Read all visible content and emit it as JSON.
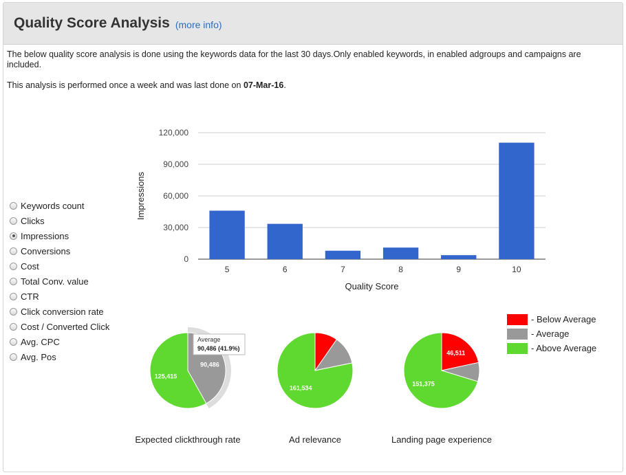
{
  "header": {
    "title": "Quality Score Analysis",
    "more_info": "(more info)"
  },
  "description": {
    "line1": "The below quality score analysis is done using the keywords data for the last 30 days.Only enabled keywords, in enabled adgroups and campaigns are included.",
    "line2_prefix": "This analysis is performed once a week and was last done on ",
    "line2_date": "07-Mar-16",
    "line2_suffix": "."
  },
  "metrics": {
    "selected": "Impressions",
    "options": [
      "Keywords count",
      "Clicks",
      "Impressions",
      "Conversions",
      "Cost",
      "Total Conv. value",
      "CTR",
      "Click conversion rate",
      "Cost / Converted Click",
      "Avg. CPC",
      "Avg. Pos"
    ]
  },
  "legend": {
    "items": [
      {
        "label": "- Below Average",
        "color": "#ff0000"
      },
      {
        "label": "- Average",
        "color": "#999999"
      },
      {
        "label": "- Above Average",
        "color": "#5fd92f"
      }
    ]
  },
  "chart_data": [
    {
      "type": "bar",
      "categories": [
        "5",
        "6",
        "7",
        "8",
        "9",
        "10"
      ],
      "values": [
        46000,
        33500,
        8000,
        11000,
        3800,
        110500
      ],
      "xlabel": "Quality Score",
      "ylabel": "Impressions",
      "ylim": [
        0,
        120000
      ],
      "yticks": [
        0,
        30000,
        60000,
        90000,
        120000
      ],
      "ytick_labels": [
        "0",
        "30,000",
        "60,000",
        "90,000",
        "120,000"
      ],
      "color": "#3366cc",
      "grid": true
    },
    {
      "type": "pie",
      "title": "Expected clickthrough rate",
      "labels": [
        "Below Average",
        "Average",
        "Above Average"
      ],
      "values": [
        0,
        90486,
        125415
      ],
      "colors": [
        "#ff0000",
        "#999999",
        "#5fd92f"
      ],
      "slice_labels": [
        "",
        "90,486",
        "125,415"
      ],
      "highlighted": "Average",
      "tooltip": {
        "title": "Average",
        "value": "90,486 (41.9%)"
      }
    },
    {
      "type": "pie",
      "title": "Ad relevance",
      "labels": [
        "Below Average",
        "Average",
        "Above Average"
      ],
      "values": [
        20000,
        25000,
        161534
      ],
      "colors": [
        "#ff0000",
        "#999999",
        "#5fd92f"
      ],
      "slice_labels": [
        "",
        "",
        "161,534"
      ]
    },
    {
      "type": "pie",
      "title": "Landing page experience",
      "labels": [
        "Below Average",
        "Average",
        "Above Average"
      ],
      "values": [
        46511,
        17500,
        151375
      ],
      "colors": [
        "#ff0000",
        "#999999",
        "#5fd92f"
      ],
      "slice_labels": [
        "46,511",
        "",
        "151,375"
      ]
    }
  ]
}
